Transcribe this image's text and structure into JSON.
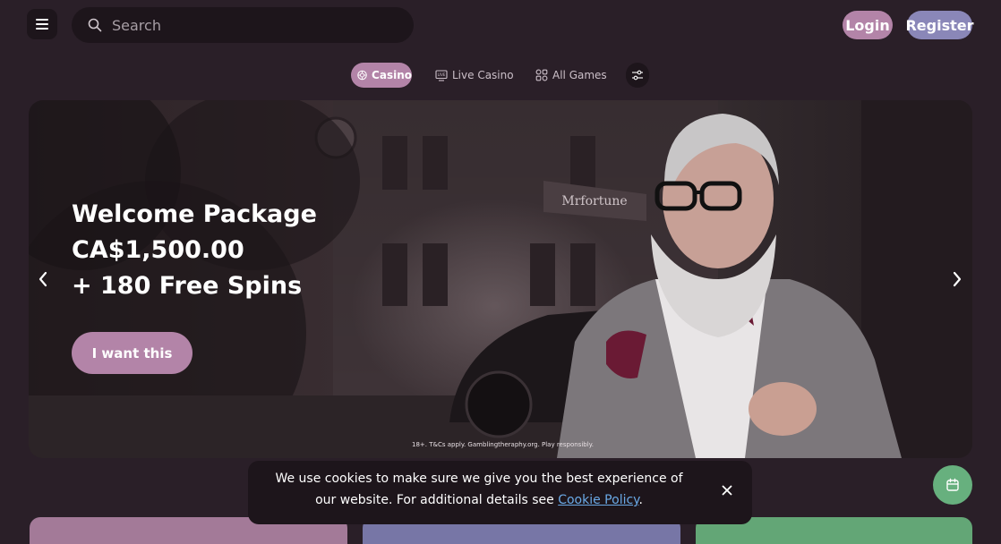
{
  "header": {
    "search": {
      "placeholder": "Search",
      "value": ""
    },
    "login_label": "Login",
    "register_label": "Register"
  },
  "tabs": [
    {
      "label": "Casino",
      "active": true,
      "icon": "casino-chip-icon"
    },
    {
      "label": "Live Casino",
      "active": false,
      "icon": "live-tv-icon"
    },
    {
      "label": "All Games",
      "active": false,
      "icon": "grid-icon"
    },
    {
      "label": "",
      "active": false,
      "icon": "filter-sliders-icon"
    }
  ],
  "banner": {
    "headline": [
      "Welcome Package",
      "CA$1,500.00",
      "+ 180 Free Spins"
    ],
    "cta_label": "I want this",
    "disclaimer": "18+. T&Cs apply. Gamblingtheraphy.org. Play responsibly.",
    "sign_text": "Mrfortune"
  },
  "cookie": {
    "text_before": "We use cookies to make sure we give you the best experience of our website. For additional details see ",
    "link_label": "Cookie Policy",
    "text_after": "."
  },
  "colors": {
    "background": "#2a1f28",
    "surface": "#1d151b",
    "accent": "#b384a8",
    "register": "#8a87b8",
    "fab": "#67b07e",
    "link": "#6aa9e6"
  }
}
